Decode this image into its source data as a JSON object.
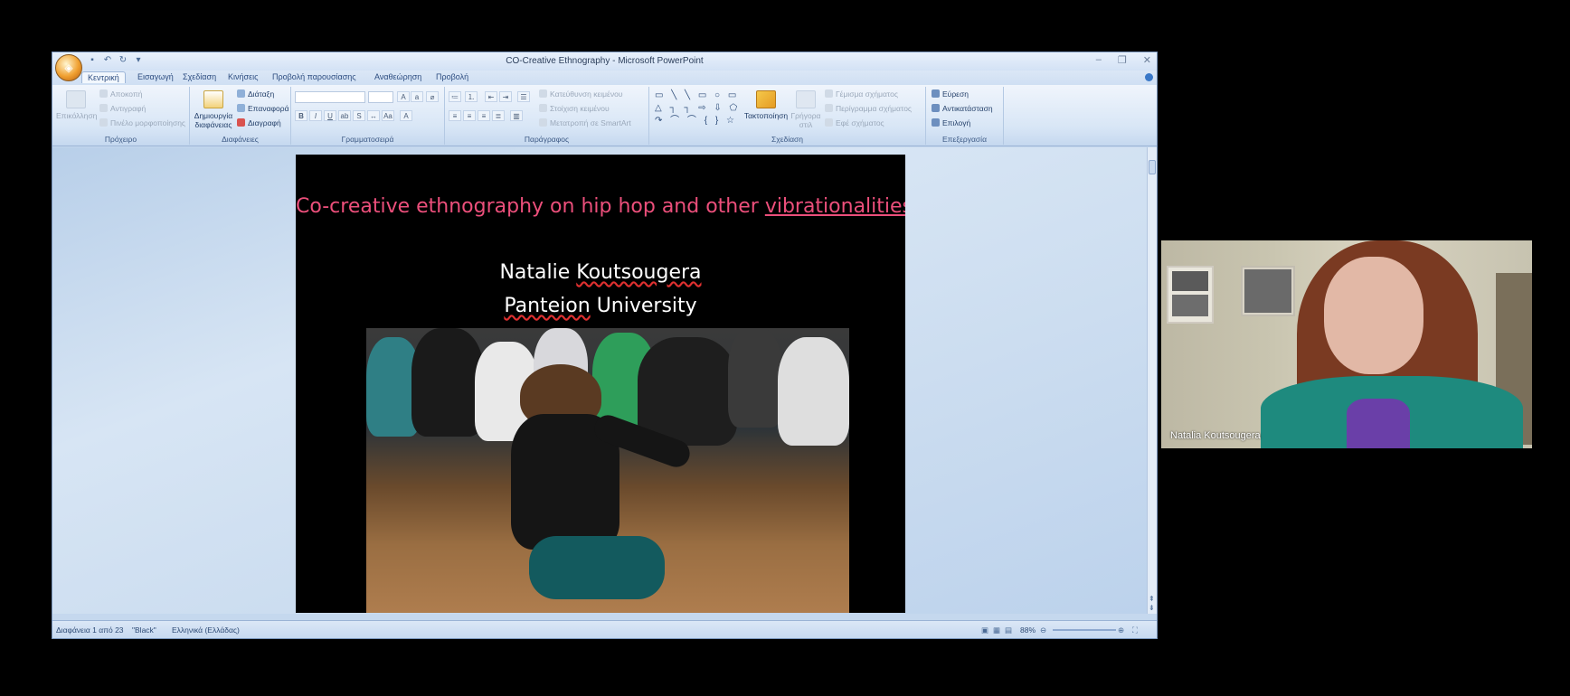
{
  "window": {
    "title": "CO-Creative Ethnography - Microsoft PowerPoint"
  },
  "tabs": [
    "Κεντρική",
    "Εισαγωγή",
    "Σχεδίαση",
    "Κινήσεις",
    "Προβολή παρουσίασης",
    "Αναθεώρηση",
    "Προβολή"
  ],
  "ribbon": {
    "clipboard": {
      "label": "Πρόχειρο",
      "paste": "Επικόλληση",
      "cut": "Αποκοπή",
      "copy": "Αντιγραφή",
      "format_painter": "Πινέλο μορφοποίησης"
    },
    "slides": {
      "label": "Διαφάνειες",
      "new_slide": "Δημιουργία διαφάνειας",
      "layout": "Διάταξη",
      "reset": "Επαναφορά",
      "delete": "Διαγραφή"
    },
    "font": {
      "label": "Γραμματοσειρά"
    },
    "paragraph": {
      "label": "Παράγραφος",
      "text_direction": "Κατεύθυνση κειμένου",
      "align_text": "Στοίχιση κειμένου",
      "smartart": "Μετατροπή σε SmartArt"
    },
    "drawing": {
      "label": "Σχεδίαση",
      "arrange": "Τακτοποίηση",
      "quick_styles": "Γρήγορα στιλ",
      "shape_fill": "Γέμισμα σχήματος",
      "shape_outline": "Περίγραμμα σχήματος",
      "shape_effects": "Εφέ σχήματος"
    },
    "editing": {
      "label": "Επεξεργασία",
      "find": "Εύρεση",
      "replace": "Αντικατάσταση",
      "select": "Επιλογή"
    }
  },
  "slide": {
    "title_part1": "Co-creative ethnography on hip hop and other ",
    "title_part2": "vibrationalities",
    "author_first": "Natalie ",
    "author_last": "Koutsougera",
    "affil_first": "Panteion",
    "affil_rest": " University"
  },
  "statusbar": {
    "slide_counter": "Διαφάνεια 1 από 23",
    "theme": "\"Black\"",
    "language": "Ελληνικά (Ελλάδας)",
    "zoom": "88%"
  },
  "video": {
    "participant_name": "Natalia Koutsougera"
  },
  "colors": {
    "slide_title": "#ec4f7b",
    "ribbon_bg": "#dbe7f6"
  }
}
